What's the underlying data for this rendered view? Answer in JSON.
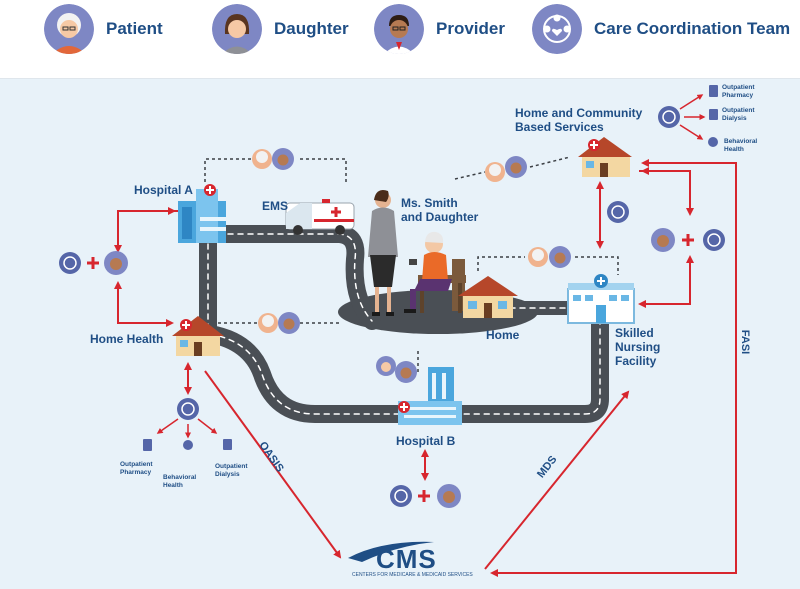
{
  "legend": {
    "patient": "Patient",
    "daughter": "Daughter",
    "provider": "Provider",
    "care_team": "Care Coordination Team"
  },
  "labels": {
    "hospital_a": "Hospital A",
    "ems": "EMS",
    "ms_smith": "Ms. Smith",
    "and_daughter": "and Daughter",
    "hcbs_line1": "Home and Community",
    "hcbs_line2": "Based Services",
    "home": "Home",
    "snf_line1": "Skilled",
    "snf_line2": "Nursing",
    "snf_line3": "Facility",
    "home_health": "Home Health",
    "hospital_b": "Hospital B"
  },
  "services_top": {
    "pharmacy_1": "Outpatient",
    "pharmacy_2": "Pharmacy",
    "dialysis_1": "Outpatient",
    "dialysis_2": "Dialysis",
    "behavioral_1": "Behavioral",
    "behavioral_2": "Health"
  },
  "services_bottom": {
    "pharmacy_1": "Outpatient",
    "pharmacy_2": "Pharmacy",
    "behavioral_1": "Behavioral",
    "behavioral_2": "Health",
    "dialysis_1": "Outpatient",
    "dialysis_2": "Dialysis"
  },
  "assessments": {
    "oasis": "OASIS",
    "mds": "MDS",
    "fasi": "FASI"
  },
  "cms": {
    "logo": "CMS",
    "tagline": "CENTERS FOR MEDICARE & MEDICAID SERVICES"
  },
  "colors": {
    "title_blue": "#1f4e85",
    "arrow_red": "#d7262e",
    "road": "#4a4f55",
    "background": "#e8f2f9",
    "team_icon": "#5566a8"
  }
}
